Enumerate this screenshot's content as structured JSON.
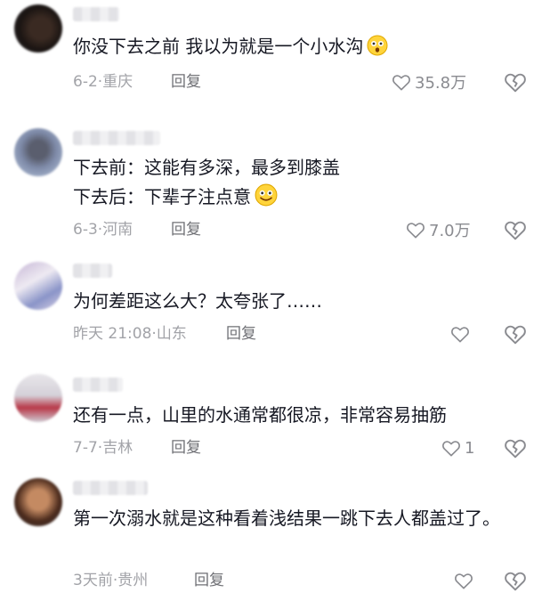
{
  "comments": [
    {
      "text": "你没下去之前 我以为就是一个小水沟",
      "emoji": "astonished-emoji",
      "date": "6-2",
      "location": "重庆",
      "reply": "回复",
      "likes": "35.8万"
    },
    {
      "text": "下去前：这能有多深，最多到膝盖\n下去后：下辈子注点意",
      "emoji": "nervous-smile-emoji",
      "date": "6-3",
      "location": "河南",
      "reply": "回复",
      "likes": "7.0万"
    },
    {
      "text": "为何差距这么大？太夸张了……",
      "date": "昨天 21:08",
      "location": "山东",
      "reply": "回复",
      "likes": ""
    },
    {
      "text": "还有一点，山里的水通常都很凉，非常容易抽筋",
      "date": "7-7",
      "location": "吉林",
      "reply": "回复",
      "likes": "1"
    },
    {
      "text": "第一次溺水就是这种看着浅结果一跳下去人都盖过了。",
      "date": "3天前",
      "location": "贵州",
      "reply": "回复",
      "likes": ""
    }
  ],
  "meta_separator": "·",
  "icons": {
    "like": "heart-outline-icon",
    "dislike": "broken-heart-outline-icon"
  },
  "colors": {
    "text": "#161823",
    "meta": "#a2a3a8",
    "icon": "#8a8b90"
  }
}
